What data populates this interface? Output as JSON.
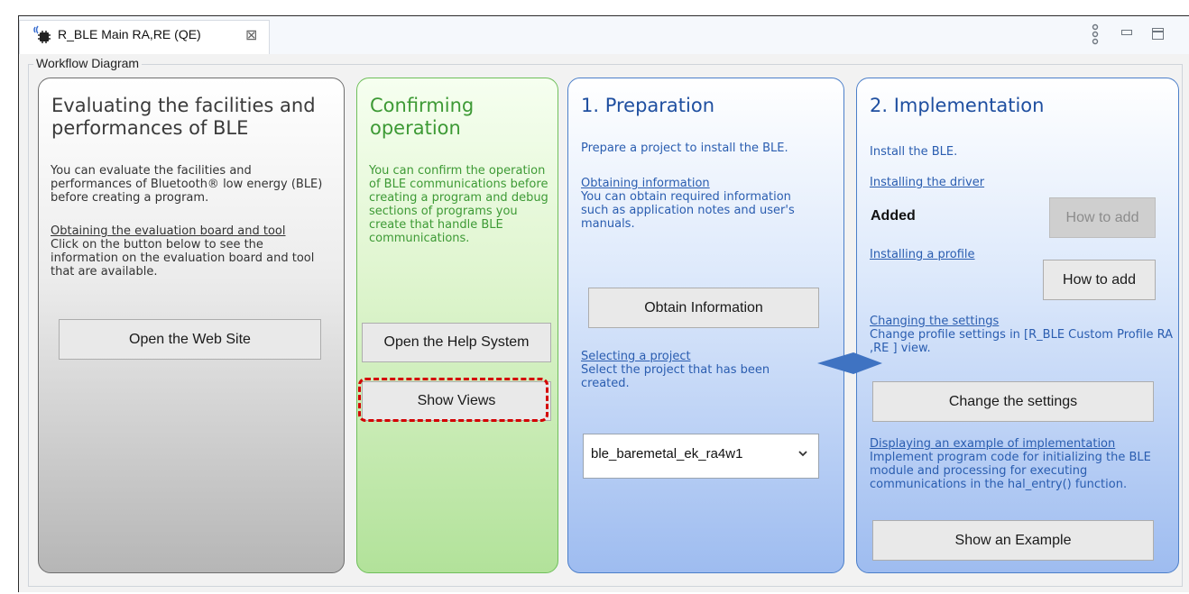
{
  "tab": {
    "title": "R_BLE Main RA,RE (QE)",
    "close_glyph": "⊠",
    "icon": "ble-chip-icon"
  },
  "view_controls": {
    "menu_icon": "view-menu-icon",
    "minimize_icon": "minimize-icon",
    "maximize_icon": "maximize-icon"
  },
  "workflow": {
    "label": "Workflow Diagram"
  },
  "panels": {
    "evaluate": {
      "title": "Evaluating the facilities and performances of BLE",
      "desc": "You can evaluate the facilities and performances of Bluetooth® low energy (BLE) before creating a program.",
      "link": "Obtaining the evaluation board and tool",
      "link_desc": "Click on the button below to see the information on the evaluation board and tool that are available.",
      "button": "Open the Web Site"
    },
    "confirm": {
      "title": "Confirming operation",
      "desc": "You can confirm the operation of BLE communications before creating a program and debug sections of programs you create that handle BLE communications.",
      "button_help": "Open the Help System",
      "button_views": "Show Views"
    },
    "preparation": {
      "title": "1. Preparation",
      "desc": "Prepare a project to install the BLE.",
      "link_info": "Obtaining information",
      "info_desc": "You can obtain required information such as application notes and user's manuals.",
      "button": "Obtain Information",
      "link_project": "Selecting a project",
      "project_desc": "Select the project that has been created.",
      "project_value": "ble_baremetal_ek_ra4w1"
    },
    "implementation": {
      "title": "2. Implementation",
      "desc": "Install the BLE.",
      "link_driver": "Installing the driver",
      "driver_status": "Added",
      "button_driver": "How to add",
      "link_profile": "Installing a profile",
      "button_profile": "How to add",
      "link_settings": "Changing the settings",
      "settings_desc": "Change profile settings in [R_BLE Custom Profile RA ,RE ] view.",
      "button_settings": "Change the settings",
      "link_example": "Displaying an example of implementation",
      "example_desc": "Implement program code for initializing the BLE module and processing for executing communications in the hal_entry() function.",
      "button_example": "Show an Example"
    }
  },
  "colors": {
    "green_title": "#3d9a35",
    "blue_title": "#1f4fa0",
    "highlight": "#d40000",
    "arrow": "#3f73c2"
  }
}
